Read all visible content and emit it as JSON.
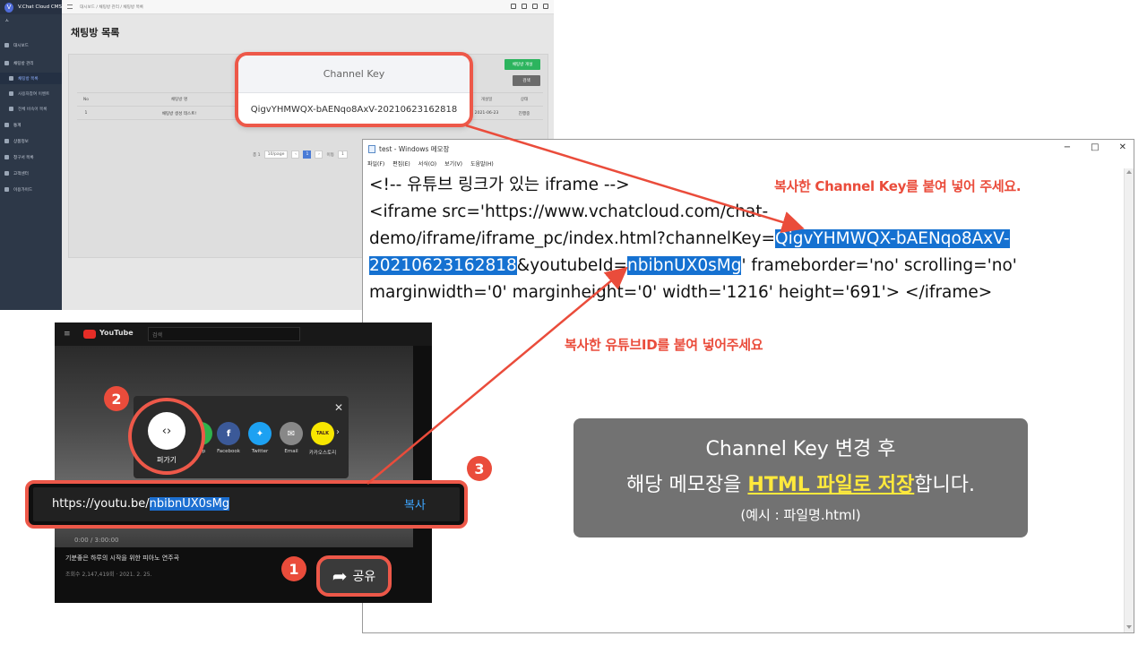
{
  "cms": {
    "logo": "V",
    "app_name": "V.Chat Cloud CMS",
    "user": "ㅅ",
    "breadcrumb": "대시보드  /  채팅방 관리  /  채팅방 목록",
    "page_title": "채팅방 목록",
    "sidebar": [
      {
        "label": "대시보드"
      },
      {
        "label": "채팅방 관리"
      },
      {
        "label": "채팅방 목록"
      },
      {
        "label": "사용자참여 이벤트"
      },
      {
        "label": "전체 비속어 목록"
      },
      {
        "label": "통계"
      },
      {
        "label": "상품정보"
      },
      {
        "label": "청구서 목록"
      },
      {
        "label": "고객센터"
      },
      {
        "label": "이용가이드"
      }
    ],
    "create_button": "채팅방 개설",
    "search_button": "검색",
    "table": {
      "headers": [
        "No",
        "채팅방 명",
        "개설일",
        "상태"
      ],
      "row": [
        "1",
        "채팅방 생성 테스트!",
        "2021-06-23",
        "진행중"
      ]
    },
    "pager": {
      "total": "총 1",
      "per_page": "10/page",
      "current": "1",
      "goto": "이동",
      "goto_value": "1"
    }
  },
  "channel_key_panel": {
    "header": "Channel Key",
    "value": "QigvYHMWQX-bAENqo8AxV-20210623162818"
  },
  "notepad": {
    "title": "test - Windows 메모장",
    "menu": [
      "파일(F)",
      "편집(E)",
      "서식(O)",
      "보기(V)",
      "도움말(H)"
    ],
    "lines": {
      "l1": "<!-- 유튜브 링크가 있는 iframe -->",
      "l2": "<iframe src='https://www.vchatcloud.com/chat-",
      "l3_pre": "demo/iframe/iframe_pc/index.html?channelKey=",
      "l3_key": "QigvYHMWQX-bAENqo8AxV-",
      "l4_key": "20210623162818",
      "l4_mid": "&youtubeId=",
      "l4_yt": "nbibnUX0sMg",
      "l4_post": "' frameborder='no' scrolling='no'",
      "l5": "marginwidth='0' marginheight='0' width='1216' height='691'> </iframe>"
    }
  },
  "notes": {
    "channel_key": "복사한 Channel Key를 붙여 넣어 주세요.",
    "youtube_id": "복사한 유튜브ID를 붙여 넣어주세요"
  },
  "save_box": {
    "line1": "Channel Key 변경 후",
    "line2_pre": "해당 메모장을 ",
    "line2_hl": "HTML 파일로 저장",
    "line2_post": "합니다.",
    "line3": "(예시 : 파일명.html)"
  },
  "youtube": {
    "brand": "YouTube",
    "search_placeholder": "검색",
    "share_targets": [
      {
        "label": "App",
        "color": "#2fb24c"
      },
      {
        "label": "Facebook",
        "color": "#3b5998"
      },
      {
        "label": "Twitter",
        "color": "#1da1f2"
      },
      {
        "label": "Email",
        "color": "#888888"
      },
      {
        "label": "카카오스토리",
        "color": "#f7e600"
      }
    ],
    "embed_label": "퍼가기",
    "url_prefix": "https://youtu.be/",
    "url_id": "nbibnUX0sMg",
    "copy_label": "복사",
    "share_label": "공유",
    "video_title": "기분좋은 하루의 시작을 위한 피아노 연주곡",
    "video_meta": "조회수 2,147,419회 · 2021. 2. 25.",
    "time": "0:00 / 3:00:00"
  },
  "steps": [
    "1",
    "2",
    "3"
  ],
  "colors": {
    "accent_red": "#ea4c3b",
    "highlight_blue": "#1571d1",
    "highlight_yellow": "#ffe93c"
  }
}
